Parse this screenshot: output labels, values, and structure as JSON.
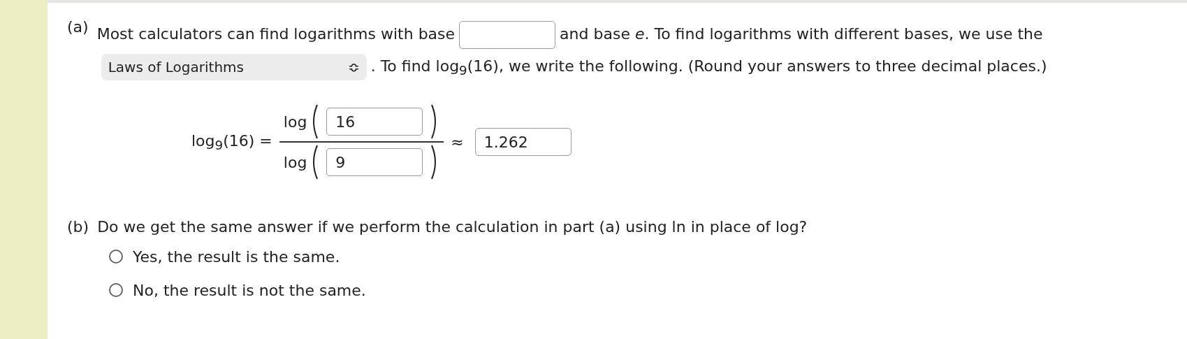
{
  "part_a": {
    "label": "(a)",
    "text_before_field": "Most calculators can find logarithms with base",
    "text_after_field": "and base *e*. To find logarithms with different bases, we use the",
    "dropdown": {
      "value": "Laws of Logarithms",
      "caret": "≎"
    },
    "text_after_dropdown": ". To find log$_{9}$(16), we write the following. (Round your answers to three decimal places.)",
    "equation": {
      "lhs": "log$_{9}$(16) =",
      "numerator_log": "log",
      "numerator_value": "16",
      "denominator_log": "log",
      "denominator_value": "9",
      "approx": "≈",
      "result": "1.262"
    }
  },
  "part_b": {
    "label": "(b)",
    "question": "Do we get the same answer if we perform the calculation in part (a) using ln in place of log?",
    "options": [
      {
        "label": "Yes, the result is the same.",
        "selected": false
      },
      {
        "label": "No, the result is not the same.",
        "selected": false
      }
    ]
  }
}
